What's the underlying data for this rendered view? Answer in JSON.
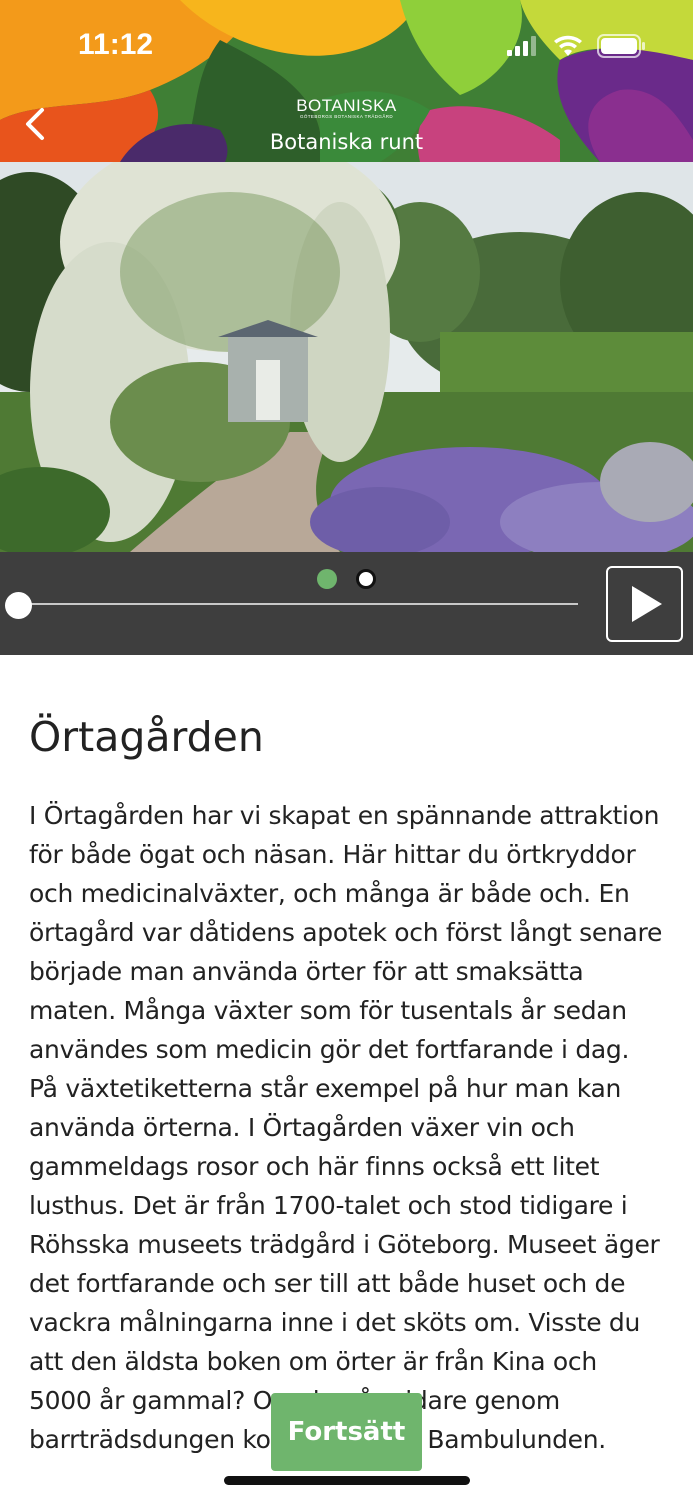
{
  "status_bar": {
    "time": "11:12"
  },
  "header": {
    "brand": "BOTANISKA",
    "brand_subtitle": "GÖTEBORGS BOTANISKA TRÄDGÅRD",
    "title": "Botaniska runt",
    "back_icon": "chevron-left-icon"
  },
  "image": {
    "description_icon": "garden-photo"
  },
  "player": {
    "pages": 2,
    "current_page": 1,
    "progress": 0,
    "play_icon": "play-icon"
  },
  "article": {
    "title": "Örtagården",
    "body": "I Örtagården har vi skapat en spännande attraktion för både ögat och näsan. Här hittar du örtkryddor och medicinalväxter, och många är både och. En örtagård var dåtidens apotek och först långt senare började man använda örter för att smaksätta maten. Många växter som för tusentals år sedan användes som medicin gör det fortfarande i dag. På växtetiketterna står exempel på hur man kan använda örterna. I Örtagården växer vin och gammeldags rosor och här finns också ett litet lusthus. Det är från 1700-talet och stod tidigare i Röhsska museets trädgård i Göteborg. Museet äger det fortfarande och ser till att både huset och de vackra målningarna inne i det sköts om. Visste du att den äldsta boken om örter är från Kina och 5000 år gammal? Om du går vidare genom barrträdsdungen kommer du till Bambulunden."
  },
  "continue_button": {
    "label": "Fortsätt"
  },
  "colors": {
    "accent_green": "#6fb56d",
    "player_bg": "#3e3e3e",
    "text": "#222222"
  }
}
